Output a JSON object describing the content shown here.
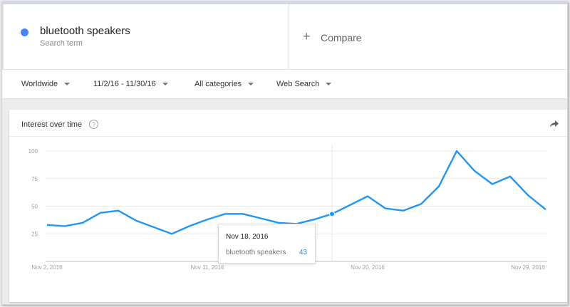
{
  "search_term": {
    "name": "bluetooth speakers",
    "subtitle": "Search term",
    "color": "#4285f4"
  },
  "compare": {
    "label": "Compare",
    "icon": "plus-icon"
  },
  "filters": {
    "region": "Worldwide",
    "date_range": "11/2/16 - 11/30/16",
    "category": "All categories",
    "search_type": "Web Search"
  },
  "card": {
    "title": "Interest over time",
    "help_icon": "help-circle-icon",
    "share_icon": "share-icon"
  },
  "tooltip": {
    "date": "Nov 18, 2016",
    "term": "bluetooth speakers",
    "value": "43",
    "index": 16
  },
  "chart_data": {
    "type": "line",
    "title": "",
    "xlabel": "",
    "ylabel": "",
    "x": [
      "Nov 2",
      "Nov 3",
      "Nov 4",
      "Nov 5",
      "Nov 6",
      "Nov 7",
      "Nov 8",
      "Nov 9",
      "Nov 10",
      "Nov 11",
      "Nov 12",
      "Nov 13",
      "Nov 14",
      "Nov 15",
      "Nov 16",
      "Nov 17",
      "Nov 18",
      "Nov 19",
      "Nov 20",
      "Nov 21",
      "Nov 22",
      "Nov 23",
      "Nov 24",
      "Nov 25",
      "Nov 26",
      "Nov 27",
      "Nov 28",
      "Nov 29",
      "Nov 30"
    ],
    "x_tick_labels": [
      "Nov 2, 2016",
      "Nov 11, 2016",
      "Nov 20, 2016",
      "Nov 29, 2016"
    ],
    "y_ticks": [
      25,
      50,
      75,
      100
    ],
    "ylim": [
      0,
      100
    ],
    "grid": true,
    "series": [
      {
        "name": "bluetooth speakers",
        "color": "#2196f3",
        "values": [
          33,
          32,
          35,
          44,
          46,
          37,
          31,
          25,
          32,
          38,
          43,
          43,
          39,
          35,
          34,
          38,
          43,
          51,
          59,
          48,
          46,
          52,
          68,
          100,
          82,
          70,
          77,
          60,
          47
        ]
      }
    ]
  }
}
